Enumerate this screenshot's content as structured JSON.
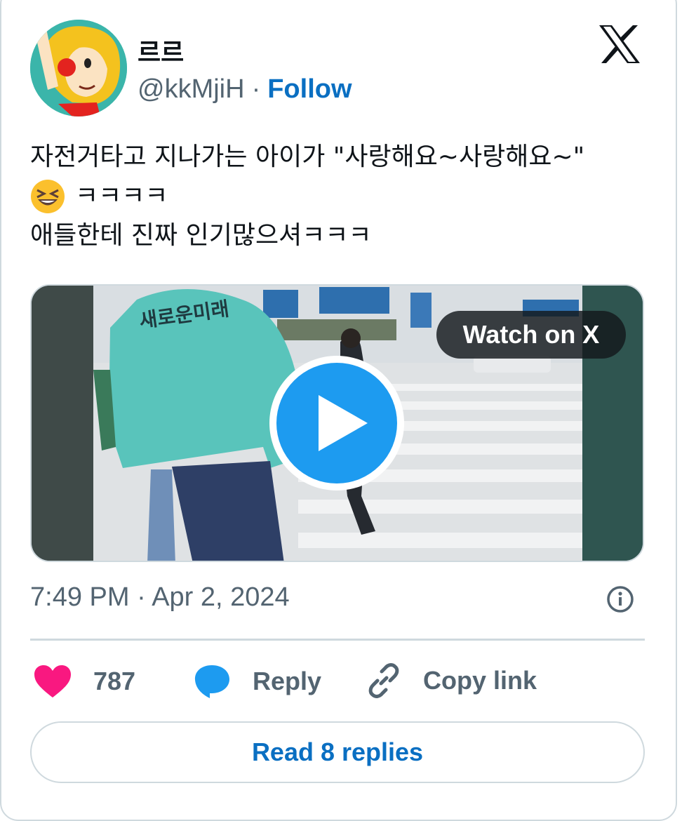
{
  "author": {
    "display_name": "르르",
    "handle": "@kkMjiH",
    "separator": "·",
    "follow_label": "Follow"
  },
  "brand_icon": "x-logo-icon",
  "tweet": {
    "line1": "자전거타고 지나가는 아이가 \"사랑해요~사랑해요~\"",
    "line2_emoji": "grinning-squinting-face-emoji",
    "line2_text": "ㅋㅋㅋㅋ",
    "line3": "애들한테 진짜 인기많으셔ㅋㅋㅋ"
  },
  "media": {
    "watch_label": "Watch on X",
    "play_icon": "play-icon",
    "jacket_text": "새로운미래"
  },
  "timestamp": "7:49 PM · Apr 2, 2024",
  "actions": {
    "like_count": "787",
    "reply_label": "Reply",
    "copy_label": "Copy link"
  },
  "read_replies_label": "Read 8 replies",
  "colors": {
    "accent": "#1d9bf0",
    "link": "#0a6fc2",
    "like": "#f91880",
    "muted": "#536471",
    "border": "#cfd9de"
  }
}
